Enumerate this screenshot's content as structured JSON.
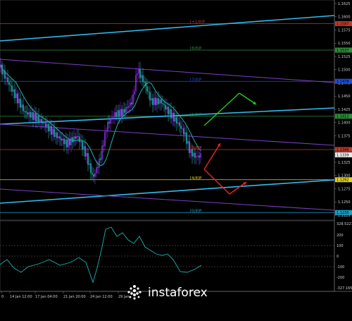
{
  "price_axis": {
    "labels": [
      "1.1625",
      "1.1600",
      "1.1575",
      "1.1550",
      "1.1525",
      "1.1500",
      "1.1475",
      "1.1450",
      "1.1425",
      "1.1400",
      "1.1375",
      "1.1350",
      "1.1325",
      "1.1300",
      "1.1275",
      "1.1250",
      "1.1225"
    ],
    "tags": [
      {
        "text": "1.1587",
        "value": 1.1587,
        "color": "#c0392b"
      },
      {
        "text": "1.1537",
        "value": 1.1537,
        "color": "#2e8b3a"
      },
      {
        "text": "1.1478",
        "value": 1.1478,
        "color": "#1f4fd6"
      },
      {
        "text": "1.1412",
        "value": 1.1412,
        "color": "#2e8b3a"
      },
      {
        "text": "1.1349",
        "value": 1.1349,
        "color": "#c0392b"
      },
      {
        "text": "1.1339",
        "value": 1.1339,
        "color": "#e8e8e8"
      },
      {
        "text": "1.1292",
        "value": 1.1292,
        "color": "#e0d020"
      },
      {
        "text": "1.1230",
        "value": 1.123,
        "color": "#1aa0c8"
      }
    ]
  },
  "level_labels": [
    {
      "text": "[+1/8]P",
      "value": 1.1587,
      "color": "#c0392b"
    },
    {
      "text": "[8/8]P",
      "value": 1.1537,
      "color": "#2e8b3a"
    },
    {
      "text": "[7/8]P",
      "value": 1.1478,
      "color": "#1f4fd6"
    },
    {
      "text": "[6/8]P",
      "value": 1.1412,
      "color": "#2e8b3a"
    },
    {
      "text": "[5/8]P",
      "value": 1.1349,
      "color": "#c0392b"
    },
    {
      "text": "[4/8]P",
      "value": 1.1292,
      "color": "#e0d020"
    },
    {
      "text": "[0/8]P",
      "value": 1.123,
      "color": "#1aa0c8"
    }
  ],
  "indicator_axis": {
    "labels": [
      "328.5227",
      "200",
      "100",
      "0",
      "-100",
      "-200",
      "-327.1657"
    ]
  },
  "time_axis": {
    "labels": [
      "0",
      "14 Jan 12:00",
      "17 Jan 04:00",
      "21 Jan 20:00",
      "24 Jan 12:00",
      "29 Jan",
      "",
      "",
      "",
      "",
      "",
      "",
      "",
      "",
      ""
    ]
  },
  "watermark": {
    "text": "instaforex"
  },
  "colors": {
    "background": "#000000",
    "bull_candle": "#8a2be2",
    "bear_candle": "#20b2aa",
    "ma_line": "#20b2aa",
    "channel_outer": "#33bbee",
    "channel_purple": "#7b3fc4",
    "arrow_up": "#22cc22",
    "arrow_down": "#ee2222"
  }
}
